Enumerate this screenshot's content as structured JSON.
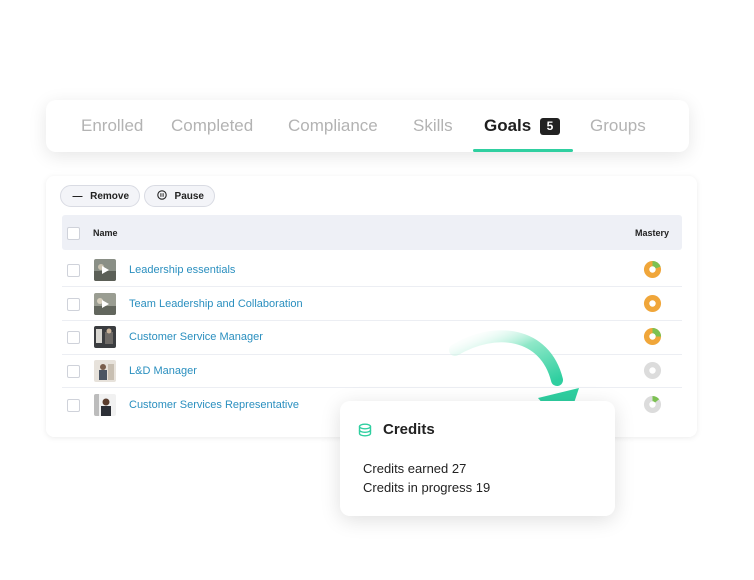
{
  "tabs": [
    {
      "label": "Enrolled",
      "active": false
    },
    {
      "label": "Completed",
      "active": false
    },
    {
      "label": "Compliance",
      "active": false
    },
    {
      "label": "Skills",
      "active": false
    },
    {
      "label": "Goals",
      "active": true,
      "badge": "5"
    },
    {
      "label": "Groups",
      "active": false
    }
  ],
  "toolbar": {
    "remove_label": "Remove",
    "pause_label": "Pause"
  },
  "table": {
    "columns": {
      "name": "Name",
      "mastery": "Mastery"
    },
    "rows": [
      {
        "name": "Leadership essentials",
        "mastery_icon": "mastery-partial-green-orange-icon"
      },
      {
        "name": "Team Leadership and Collaboration",
        "mastery_icon": "mastery-orange-icon"
      },
      {
        "name": "Customer Service Manager",
        "mastery_icon": "mastery-partial-green-orange-icon"
      },
      {
        "name": "L&D Manager",
        "mastery_icon": "mastery-empty-icon"
      },
      {
        "name": "Customer Services Representative",
        "mastery_icon": "mastery-low-green-icon"
      }
    ]
  },
  "credits": {
    "title": "Credits",
    "earned_text": "Credits earned 27",
    "in_progress_text": "Credits in progress 19"
  },
  "colors": {
    "accent": "#2fcfa0",
    "link": "#2a8fbf",
    "mastery_orange": "#f0a63a",
    "mastery_green": "#7cc152"
  }
}
